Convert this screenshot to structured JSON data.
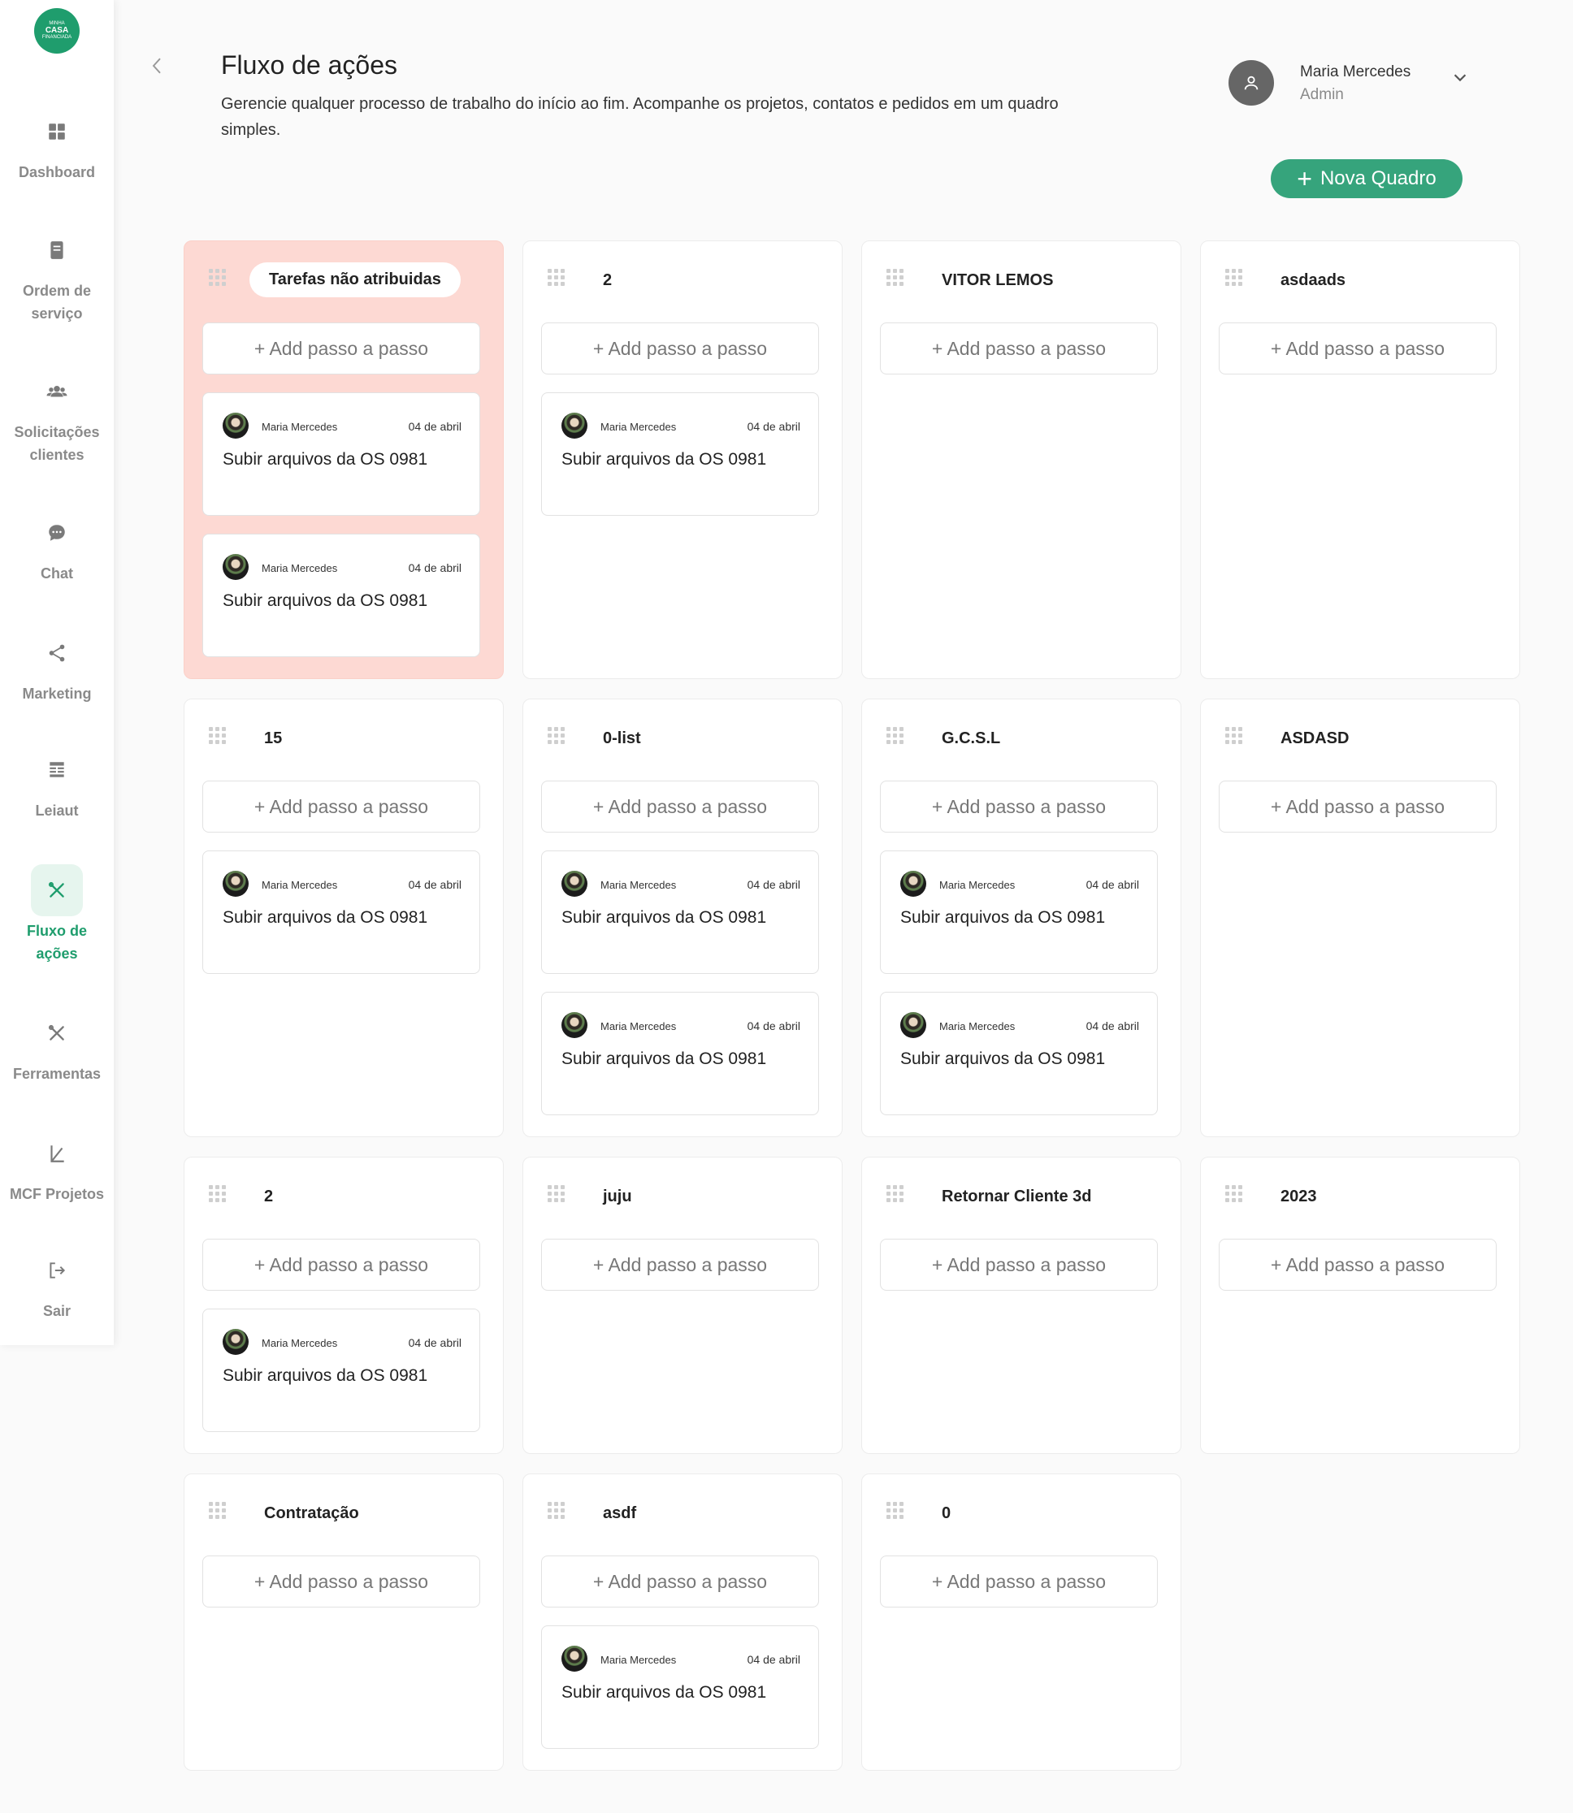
{
  "brand": {
    "logo_line1": "MINHA",
    "logo_line2": "CASA",
    "logo_line3": "FINANCIADA"
  },
  "sidebar": {
    "items": [
      {
        "label": "Dashboard",
        "icon": "grid-icon"
      },
      {
        "label": "Ordem de serviço",
        "icon": "document-icon"
      },
      {
        "label": "Solicitações clientes",
        "icon": "users-icon"
      },
      {
        "label": "Chat",
        "icon": "chat-bubble-icon"
      },
      {
        "label": "Marketing",
        "icon": "share-icon"
      },
      {
        "label": "Leiaut",
        "icon": "layout-icon"
      },
      {
        "label": "Fluxo de ações",
        "icon": "tools-icon",
        "active": true
      },
      {
        "label": "Ferramentas",
        "icon": "tools-icon"
      },
      {
        "label": "MCF Projetos",
        "icon": "ruler-icon"
      },
      {
        "label": "Sair",
        "icon": "logout-icon"
      }
    ]
  },
  "header": {
    "title": "Fluxo de ações",
    "description": "Gerencie qualquer processo de trabalho do início ao fim. Acompanhe os projetos, contatos e pedidos em um quadro simples."
  },
  "user": {
    "name": "Maria Mercedes",
    "role": "Admin"
  },
  "actions": {
    "new_board": "Nova Quadro"
  },
  "colors": {
    "accent": "#36a47c",
    "active_nav": "#1f9d6d",
    "unassigned_bg": "#fdd9d3"
  },
  "add_label": "+ Add passo a passo",
  "columns": [
    {
      "title": "Tarefas não atribuidas",
      "highlight": true,
      "tasks": [
        {
          "author": "Maria Mercedes",
          "date": "04 de abril",
          "title": "Subir arquivos da OS 0981"
        },
        {
          "author": "Maria Mercedes",
          "date": "04 de abril",
          "title": "Subir arquivos da OS 0981"
        }
      ]
    },
    {
      "title": "2",
      "tasks": [
        {
          "author": "Maria Mercedes",
          "date": "04 de abril",
          "title": "Subir arquivos da OS 0981"
        }
      ]
    },
    {
      "title": "VITOR LEMOS",
      "tasks": []
    },
    {
      "title": "asdaads",
      "tasks": []
    },
    {
      "title": "15",
      "tasks": [
        {
          "author": "Maria Mercedes",
          "date": "04 de abril",
          "title": "Subir arquivos da OS 0981"
        }
      ]
    },
    {
      "title": "0-list",
      "tasks": [
        {
          "author": "Maria Mercedes",
          "date": "04 de abril",
          "title": "Subir arquivos da OS 0981"
        },
        {
          "author": "Maria Mercedes",
          "date": "04 de abril",
          "title": "Subir arquivos da OS 0981"
        }
      ]
    },
    {
      "title": "G.C.S.L",
      "tasks": [
        {
          "author": "Maria Mercedes",
          "date": "04 de abril",
          "title": "Subir arquivos da OS 0981"
        },
        {
          "author": "Maria Mercedes",
          "date": "04 de abril",
          "title": "Subir arquivos da OS 0981"
        }
      ]
    },
    {
      "title": "ASDASD",
      "tasks": []
    },
    {
      "title": "2",
      "tasks": [
        {
          "author": "Maria Mercedes",
          "date": "04 de abril",
          "title": "Subir arquivos da OS 0981"
        }
      ]
    },
    {
      "title": "juju",
      "tasks": []
    },
    {
      "title": "Retornar Cliente 3d",
      "tasks": []
    },
    {
      "title": "2023",
      "tasks": []
    },
    {
      "title": "Contratação",
      "tasks": []
    },
    {
      "title": "asdf",
      "tasks": [
        {
          "author": "Maria Mercedes",
          "date": "04 de abril",
          "title": "Subir arquivos da OS 0981"
        }
      ]
    },
    {
      "title": "0",
      "tasks": []
    }
  ]
}
